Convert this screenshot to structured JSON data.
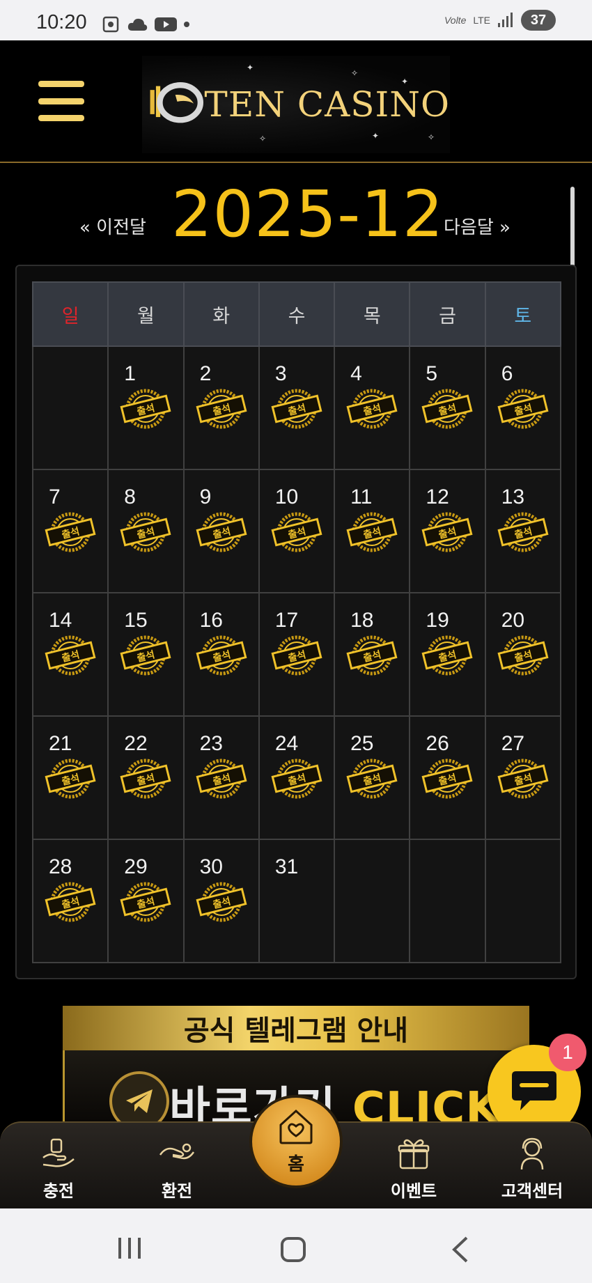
{
  "status_bar": {
    "time": "10:20",
    "network": "LTE",
    "volte": "Volte",
    "battery": "37"
  },
  "header": {
    "brand": "TEN CASINO",
    "menu_icon": "hamburger-icon"
  },
  "calendar": {
    "month_title": "2025-12",
    "prev_label": "« 이전달",
    "next_label": "다음달 »",
    "weekdays": [
      "일",
      "월",
      "화",
      "수",
      "목",
      "금",
      "토"
    ],
    "stamp_text": "출석",
    "weeks": [
      [
        {
          "d": "",
          "s": false
        },
        {
          "d": "1",
          "s": true
        },
        {
          "d": "2",
          "s": true
        },
        {
          "d": "3",
          "s": true
        },
        {
          "d": "4",
          "s": true
        },
        {
          "d": "5",
          "s": true
        },
        {
          "d": "6",
          "s": true
        }
      ],
      [
        {
          "d": "7",
          "s": true
        },
        {
          "d": "8",
          "s": true
        },
        {
          "d": "9",
          "s": true
        },
        {
          "d": "10",
          "s": true
        },
        {
          "d": "11",
          "s": true
        },
        {
          "d": "12",
          "s": true
        },
        {
          "d": "13",
          "s": true
        }
      ],
      [
        {
          "d": "14",
          "s": true
        },
        {
          "d": "15",
          "s": true
        },
        {
          "d": "16",
          "s": true
        },
        {
          "d": "17",
          "s": true
        },
        {
          "d": "18",
          "s": true
        },
        {
          "d": "19",
          "s": true
        },
        {
          "d": "20",
          "s": true
        }
      ],
      [
        {
          "d": "21",
          "s": true
        },
        {
          "d": "22",
          "s": true
        },
        {
          "d": "23",
          "s": true
        },
        {
          "d": "24",
          "s": true
        },
        {
          "d": "25",
          "s": true
        },
        {
          "d": "26",
          "s": true
        },
        {
          "d": "27",
          "s": true
        }
      ],
      [
        {
          "d": "28",
          "s": true
        },
        {
          "d": "29",
          "s": true
        },
        {
          "d": "30",
          "s": true
        },
        {
          "d": "31",
          "s": false
        },
        {
          "d": "",
          "s": false
        },
        {
          "d": "",
          "s": false
        },
        {
          "d": "",
          "s": false
        }
      ]
    ],
    "colors": {
      "sunday": "#e0242a",
      "saturday": "#5fb6e8",
      "accent": "#f6c21a"
    }
  },
  "banner": {
    "title": "공식 텔레그램 안내",
    "cta_prefix": "바로가기 ",
    "cta_click": "CLICK"
  },
  "chat": {
    "badge": "1",
    "icon": "chat-bubble-icon"
  },
  "bottom_nav": {
    "items": [
      {
        "label": "충전",
        "icon": "deposit-hand-icon"
      },
      {
        "label": "환전",
        "icon": "withdraw-hand-icon"
      },
      {
        "label": "홈",
        "icon": "home-heart-icon"
      },
      {
        "label": "이벤트",
        "icon": "gift-icon"
      },
      {
        "label": "고객센터",
        "icon": "support-agent-icon"
      }
    ]
  }
}
